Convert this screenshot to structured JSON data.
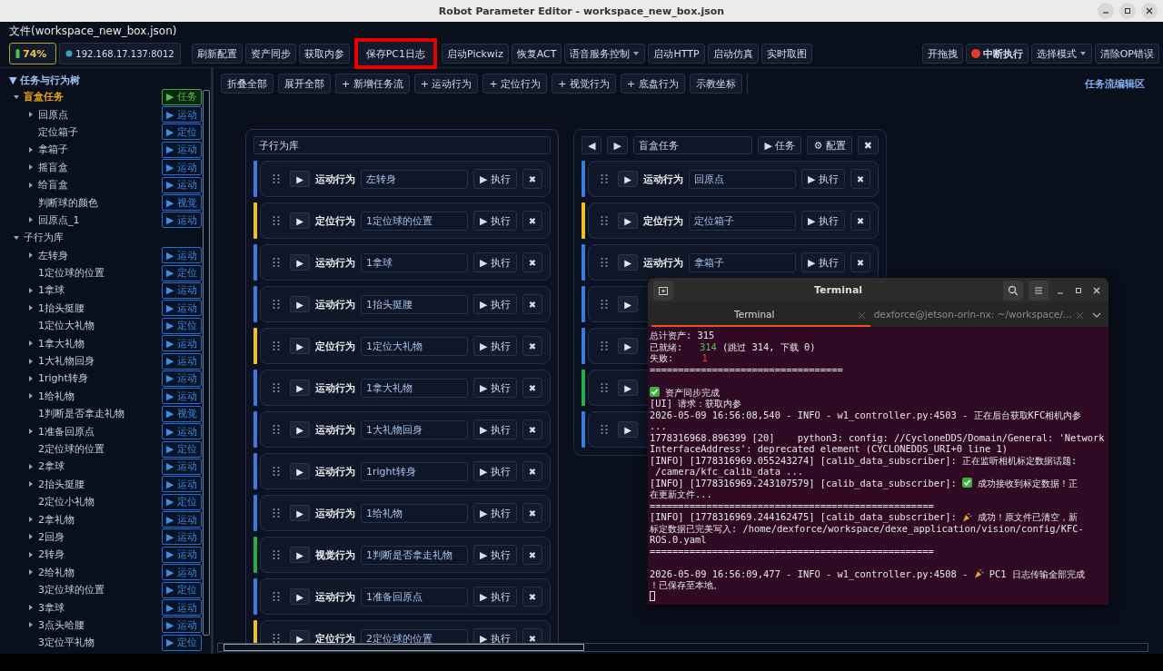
{
  "window": {
    "title": "Robot Parameter Editor - workspace_new_box.json"
  },
  "menu_bar": {
    "file_label": "文件(workspace_new_box.json)"
  },
  "toolbar": {
    "battery": "74%",
    "address": "192.168.17.137:8012",
    "buttons": [
      {
        "label": "刷新配置",
        "kind": "plain",
        "highlighted": false
      },
      {
        "label": "资产同步",
        "kind": "plain",
        "highlighted": false
      },
      {
        "label": "获取内参",
        "kind": "plain",
        "highlighted": false
      },
      {
        "label": "保存PC1日志",
        "kind": "plain",
        "highlighted": true
      },
      {
        "label": "启动Pickwiz",
        "kind": "plain",
        "highlighted": false
      },
      {
        "label": "恢复ACT",
        "kind": "plain",
        "highlighted": false
      },
      {
        "label": "语音服务控制",
        "kind": "dropdown",
        "highlighted": false
      },
      {
        "label": "启动HTTP",
        "kind": "plain",
        "highlighted": false
      },
      {
        "label": "启动仿真",
        "kind": "plain",
        "highlighted": false
      },
      {
        "label": "实时取图",
        "kind": "plain",
        "highlighted": false
      }
    ],
    "right_buttons": [
      {
        "label": "开拖拽",
        "kind": "plain"
      },
      {
        "label": "中断执行",
        "kind": "stop"
      },
      {
        "label": "选择模式",
        "kind": "dropdown"
      },
      {
        "label": "清除OP错误",
        "kind": "plain"
      }
    ]
  },
  "tree": {
    "title": "▼ 任务与行为树",
    "items": [
      {
        "label": "盲盒任务",
        "kind": "task",
        "tag": "▶ 任务",
        "expanded": true,
        "children": [
          {
            "label": "回原点",
            "tag": "▶ 运动",
            "expandable": true
          },
          {
            "label": "定位箱子",
            "tag": "▶ 定位",
            "expandable": false
          },
          {
            "label": "拿箱子",
            "tag": "▶ 运动",
            "expandable": true
          },
          {
            "label": "摇盲盒",
            "tag": "▶ 运动",
            "expandable": true
          },
          {
            "label": "给盲盒",
            "tag": "▶ 运动",
            "expandable": true
          },
          {
            "label": "判断球的颜色",
            "tag": "▶ 视觉",
            "expandable": false
          },
          {
            "label": "回原点_1",
            "tag": "▶ 运动",
            "expandable": true
          }
        ]
      },
      {
        "label": "子行为库",
        "kind": "group",
        "expanded": true,
        "children": [
          {
            "label": "左转身",
            "tag": "▶ 运动",
            "expandable": true
          },
          {
            "label": "1定位球的位置",
            "tag": "▶ 定位",
            "expandable": false
          },
          {
            "label": "1拿球",
            "tag": "▶ 运动",
            "expandable": true
          },
          {
            "label": "1抬头挺腰",
            "tag": "▶ 运动",
            "expandable": true
          },
          {
            "label": "1定位大礼物",
            "tag": "▶ 定位",
            "expandable": false
          },
          {
            "label": "1拿大礼物",
            "tag": "▶ 运动",
            "expandable": true
          },
          {
            "label": "1大礼物回身",
            "tag": "▶ 运动",
            "expandable": true
          },
          {
            "label": "1right转身",
            "tag": "▶ 运动",
            "expandable": true
          },
          {
            "label": "1给礼物",
            "tag": "▶ 运动",
            "expandable": true
          },
          {
            "label": "1判断是否拿走礼物",
            "tag": "▶ 视觉",
            "expandable": false
          },
          {
            "label": "1准备回原点",
            "tag": "▶ 运动",
            "expandable": true
          },
          {
            "label": "2定位球的位置",
            "tag": "▶ 定位",
            "expandable": false
          },
          {
            "label": "2拿球",
            "tag": "▶ 运动",
            "expandable": true
          },
          {
            "label": "2抬头挺腰",
            "tag": "▶ 运动",
            "expandable": true
          },
          {
            "label": "2定位小礼物",
            "tag": "▶ 定位",
            "expandable": false
          },
          {
            "label": "2拿礼物",
            "tag": "▶ 运动",
            "expandable": true
          },
          {
            "label": "2回身",
            "tag": "▶ 运动",
            "expandable": true
          },
          {
            "label": "2转身",
            "tag": "▶ 运动",
            "expandable": true
          },
          {
            "label": "2给礼物",
            "tag": "▶ 运动",
            "expandable": true
          },
          {
            "label": "3定位球的位置",
            "tag": "▶ 定位",
            "expandable": false
          },
          {
            "label": "3拿球",
            "tag": "▶ 运动",
            "expandable": true
          },
          {
            "label": "3点头哈腰",
            "tag": "▶ 运动",
            "expandable": true
          },
          {
            "label": "3定位平礼物",
            "tag": "▶ 定位",
            "expandable": false
          }
        ]
      }
    ]
  },
  "action_bar": {
    "buttons": [
      "折叠全部",
      "展开全部",
      "+ 新增任务流",
      "+ 运动行为",
      "+ 定位行为",
      "+ 视觉行为",
      "+ 底盘行为",
      "示教坐标"
    ],
    "title": "任务流编辑区"
  },
  "flows": [
    {
      "kind": "library",
      "title": "子行为库",
      "cards": [
        {
          "kind": "motion",
          "play": "▶",
          "type_label": "运动行为",
          "name": "左转身",
          "run": "▶ 执行",
          "remove": "✖"
        },
        {
          "kind": "locate",
          "play": "▶",
          "type_label": "定位行为",
          "name": "1定位球的位置",
          "run": "▶ 执行",
          "remove": "✖"
        },
        {
          "kind": "motion",
          "play": "▶",
          "type_label": "运动行为",
          "name": "1拿球",
          "run": "▶ 执行",
          "remove": "✖"
        },
        {
          "kind": "motion",
          "play": "▶",
          "type_label": "运动行为",
          "name": "1抬头挺腰",
          "run": "▶ 执行",
          "remove": "✖"
        },
        {
          "kind": "locate",
          "play": "▶",
          "type_label": "定位行为",
          "name": "1定位大礼物",
          "run": "▶ 执行",
          "remove": "✖"
        },
        {
          "kind": "motion",
          "play": "▶",
          "type_label": "运动行为",
          "name": "1拿大礼物",
          "run": "▶ 执行",
          "remove": "✖"
        },
        {
          "kind": "motion",
          "play": "▶",
          "type_label": "运动行为",
          "name": "1大礼物回身",
          "run": "▶ 执行",
          "remove": "✖"
        },
        {
          "kind": "motion",
          "play": "▶",
          "type_label": "运动行为",
          "name": "1right转身",
          "run": "▶ 执行",
          "remove": "✖"
        },
        {
          "kind": "motion",
          "play": "▶",
          "type_label": "运动行为",
          "name": "1给礼物",
          "run": "▶ 执行",
          "remove": "✖"
        },
        {
          "kind": "vision",
          "play": "▶",
          "type_label": "视觉行为",
          "name": "1判断是否拿走礼物",
          "run": "▶ 执行",
          "remove": "✖"
        },
        {
          "kind": "motion",
          "play": "▶",
          "type_label": "运动行为",
          "name": "1准备回原点",
          "run": "▶ 执行",
          "remove": "✖"
        },
        {
          "kind": "locate",
          "play": "▶",
          "type_label": "定位行为",
          "name": "2定位球的位置",
          "run": "▶ 执行",
          "remove": "✖"
        }
      ]
    },
    {
      "kind": "task",
      "title": "盲盒任务",
      "prev": "◀",
      "next": "▶",
      "buttons": [
        "▶ 任务",
        "⚙ 配置"
      ],
      "close": "✖",
      "cards": [
        {
          "kind": "motion",
          "play": "▶",
          "type_label": "运动行为",
          "name": "回原点",
          "run": "▶ 执行",
          "remove": "✖"
        },
        {
          "kind": "locate",
          "play": "▶",
          "type_label": "定位行为",
          "name": "定位箱子",
          "run": "▶ 执行",
          "remove": "✖"
        },
        {
          "kind": "motion",
          "play": "▶",
          "type_label": "运动行为",
          "name": "拿箱子",
          "run": "▶ 执行",
          "remove": "✖"
        },
        {
          "kind": "motion",
          "play": "▶"
        },
        {
          "kind": "motion",
          "play": "▶"
        },
        {
          "kind": "vision",
          "play": "▶"
        },
        {
          "kind": "motion",
          "play": "▶"
        }
      ]
    }
  ],
  "terminal": {
    "title": "Terminal",
    "tabs": [
      {
        "label": "Terminal",
        "selected": true
      },
      {
        "label": "dexforce@jetson-orin-nx: ~/workspace/...",
        "selected": false
      }
    ],
    "lines": [
      {
        "kind": "text",
        "segments": [
          {
            "kind": "text",
            "text": "总计资产: 315"
          }
        ]
      },
      {
        "kind": "text",
        "segments": [
          {
            "kind": "text",
            "text": "已就绪:   "
          },
          {
            "kind": "text",
            "text": "314",
            "color": "#4ec94e"
          },
          {
            "kind": "text",
            "text": " (跳过 314, 下载 0)"
          }
        ]
      },
      {
        "kind": "text",
        "segments": [
          {
            "kind": "text",
            "text": "失败:     "
          },
          {
            "kind": "text",
            "text": "1",
            "color": "#e8452c"
          }
        ]
      },
      {
        "kind": "text",
        "segments": [
          {
            "kind": "text",
            "text": "=================================="
          }
        ]
      },
      {
        "kind": "blank"
      },
      {
        "kind": "text",
        "segments": [
          {
            "kind": "check"
          },
          {
            "kind": "text",
            "text": " 资产同步完成"
          }
        ]
      },
      {
        "kind": "text",
        "segments": [
          {
            "kind": "text",
            "text": "[UI] 请求：获取内参"
          }
        ]
      },
      {
        "kind": "text",
        "segments": [
          {
            "kind": "text",
            "text": "2026-05-09 16:56:08,540 - INFO - w1_controller.py:4503 - 正在后台获取KFC相机内参"
          }
        ]
      },
      {
        "kind": "text",
        "segments": [
          {
            "kind": "text",
            "text": "..."
          }
        ]
      },
      {
        "kind": "text",
        "segments": [
          {
            "kind": "text",
            "text": "1778316968.896399 [20]    python3: config: //CycloneDDS/Domain/General: 'Network"
          }
        ]
      },
      {
        "kind": "text",
        "segments": [
          {
            "kind": "text",
            "text": "InterfaceAddress': deprecated element (CYCLONEDDS_URI+0 line 1)"
          }
        ]
      },
      {
        "kind": "text",
        "segments": [
          {
            "kind": "text",
            "text": "[INFO] [1778316969.055243274] [calib_data_subscriber]: 正在监听相机标定数据话题:"
          }
        ]
      },
      {
        "kind": "text",
        "segments": [
          {
            "kind": "text",
            "text": " /camera/kfc_calib_data ..."
          }
        ]
      },
      {
        "kind": "text",
        "segments": [
          {
            "kind": "text",
            "text": "[INFO] [1778316969.243107579] [calib_data_subscriber]: "
          },
          {
            "kind": "check"
          },
          {
            "kind": "text",
            "text": " 成功接收到标定数据！正"
          }
        ]
      },
      {
        "kind": "text",
        "segments": [
          {
            "kind": "text",
            "text": "在更新文件..."
          }
        ]
      },
      {
        "kind": "text",
        "segments": [
          {
            "kind": "text",
            "text": "=================================================="
          }
        ]
      },
      {
        "kind": "text",
        "segments": [
          {
            "kind": "text",
            "text": "[INFO] [1778316969.244162475] [calib_data_subscriber]: "
          },
          {
            "kind": "party"
          },
          {
            "kind": "text",
            "text": " 成功！原文件已清空，新"
          }
        ]
      },
      {
        "kind": "text",
        "segments": [
          {
            "kind": "text",
            "text": "标定数据已完美写入: /home/dexforce/workspace/dexe_application/vision/config/KFC-"
          }
        ]
      },
      {
        "kind": "text",
        "segments": [
          {
            "kind": "text",
            "text": "ROS.0.yaml"
          }
        ]
      },
      {
        "kind": "text",
        "segments": [
          {
            "kind": "text",
            "text": "=================================================="
          }
        ]
      },
      {
        "kind": "blank"
      },
      {
        "kind": "text",
        "segments": [
          {
            "kind": "text",
            "text": "2026-05-09 16:56:09,477 - INFO - w1_controller.py:4508 - "
          },
          {
            "kind": "party"
          },
          {
            "kind": "text",
            "text": " PC1 日志传输全部完成"
          }
        ]
      },
      {
        "kind": "text",
        "segments": [
          {
            "kind": "text",
            "text": "！已保存至本地。"
          }
        ]
      },
      {
        "kind": "cursor"
      }
    ]
  }
}
